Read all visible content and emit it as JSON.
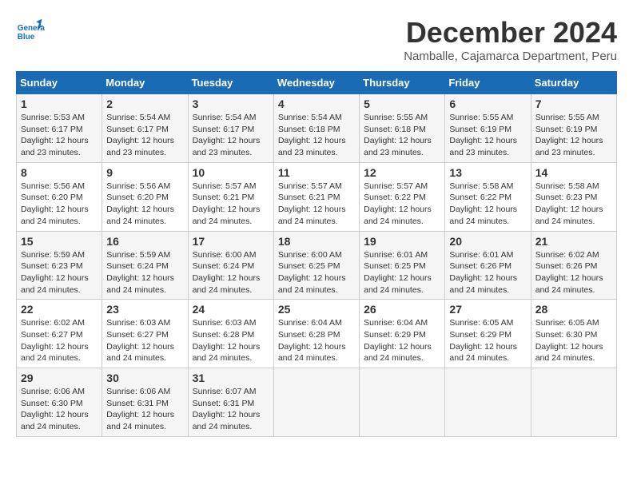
{
  "header": {
    "logo_line1": "General",
    "logo_line2": "Blue",
    "month_year": "December 2024",
    "location": "Namballe, Cajamarca Department, Peru"
  },
  "weekdays": [
    "Sunday",
    "Monday",
    "Tuesday",
    "Wednesday",
    "Thursday",
    "Friday",
    "Saturday"
  ],
  "weeks": [
    [
      {
        "day": 1,
        "sunrise": "5:53 AM",
        "sunset": "6:17 PM",
        "daylight": "12 hours and 23 minutes."
      },
      {
        "day": 2,
        "sunrise": "5:54 AM",
        "sunset": "6:17 PM",
        "daylight": "12 hours and 23 minutes."
      },
      {
        "day": 3,
        "sunrise": "5:54 AM",
        "sunset": "6:17 PM",
        "daylight": "12 hours and 23 minutes."
      },
      {
        "day": 4,
        "sunrise": "5:54 AM",
        "sunset": "6:18 PM",
        "daylight": "12 hours and 23 minutes."
      },
      {
        "day": 5,
        "sunrise": "5:55 AM",
        "sunset": "6:18 PM",
        "daylight": "12 hours and 23 minutes."
      },
      {
        "day": 6,
        "sunrise": "5:55 AM",
        "sunset": "6:19 PM",
        "daylight": "12 hours and 23 minutes."
      },
      {
        "day": 7,
        "sunrise": "5:55 AM",
        "sunset": "6:19 PM",
        "daylight": "12 hours and 23 minutes."
      }
    ],
    [
      {
        "day": 8,
        "sunrise": "5:56 AM",
        "sunset": "6:20 PM",
        "daylight": "12 hours and 24 minutes."
      },
      {
        "day": 9,
        "sunrise": "5:56 AM",
        "sunset": "6:20 PM",
        "daylight": "12 hours and 24 minutes."
      },
      {
        "day": 10,
        "sunrise": "5:57 AM",
        "sunset": "6:21 PM",
        "daylight": "12 hours and 24 minutes."
      },
      {
        "day": 11,
        "sunrise": "5:57 AM",
        "sunset": "6:21 PM",
        "daylight": "12 hours and 24 minutes."
      },
      {
        "day": 12,
        "sunrise": "5:57 AM",
        "sunset": "6:22 PM",
        "daylight": "12 hours and 24 minutes."
      },
      {
        "day": 13,
        "sunrise": "5:58 AM",
        "sunset": "6:22 PM",
        "daylight": "12 hours and 24 minutes."
      },
      {
        "day": 14,
        "sunrise": "5:58 AM",
        "sunset": "6:23 PM",
        "daylight": "12 hours and 24 minutes."
      }
    ],
    [
      {
        "day": 15,
        "sunrise": "5:59 AM",
        "sunset": "6:23 PM",
        "daylight": "12 hours and 24 minutes."
      },
      {
        "day": 16,
        "sunrise": "5:59 AM",
        "sunset": "6:24 PM",
        "daylight": "12 hours and 24 minutes."
      },
      {
        "day": 17,
        "sunrise": "6:00 AM",
        "sunset": "6:24 PM",
        "daylight": "12 hours and 24 minutes."
      },
      {
        "day": 18,
        "sunrise": "6:00 AM",
        "sunset": "6:25 PM",
        "daylight": "12 hours and 24 minutes."
      },
      {
        "day": 19,
        "sunrise": "6:01 AM",
        "sunset": "6:25 PM",
        "daylight": "12 hours and 24 minutes."
      },
      {
        "day": 20,
        "sunrise": "6:01 AM",
        "sunset": "6:26 PM",
        "daylight": "12 hours and 24 minutes."
      },
      {
        "day": 21,
        "sunrise": "6:02 AM",
        "sunset": "6:26 PM",
        "daylight": "12 hours and 24 minutes."
      }
    ],
    [
      {
        "day": 22,
        "sunrise": "6:02 AM",
        "sunset": "6:27 PM",
        "daylight": "12 hours and 24 minutes."
      },
      {
        "day": 23,
        "sunrise": "6:03 AM",
        "sunset": "6:27 PM",
        "daylight": "12 hours and 24 minutes."
      },
      {
        "day": 24,
        "sunrise": "6:03 AM",
        "sunset": "6:28 PM",
        "daylight": "12 hours and 24 minutes."
      },
      {
        "day": 25,
        "sunrise": "6:04 AM",
        "sunset": "6:28 PM",
        "daylight": "12 hours and 24 minutes."
      },
      {
        "day": 26,
        "sunrise": "6:04 AM",
        "sunset": "6:29 PM",
        "daylight": "12 hours and 24 minutes."
      },
      {
        "day": 27,
        "sunrise": "6:05 AM",
        "sunset": "6:29 PM",
        "daylight": "12 hours and 24 minutes."
      },
      {
        "day": 28,
        "sunrise": "6:05 AM",
        "sunset": "6:30 PM",
        "daylight": "12 hours and 24 minutes."
      }
    ],
    [
      {
        "day": 29,
        "sunrise": "6:06 AM",
        "sunset": "6:30 PM",
        "daylight": "12 hours and 24 minutes."
      },
      {
        "day": 30,
        "sunrise": "6:06 AM",
        "sunset": "6:31 PM",
        "daylight": "12 hours and 24 minutes."
      },
      {
        "day": 31,
        "sunrise": "6:07 AM",
        "sunset": "6:31 PM",
        "daylight": "12 hours and 24 minutes."
      },
      null,
      null,
      null,
      null
    ]
  ]
}
